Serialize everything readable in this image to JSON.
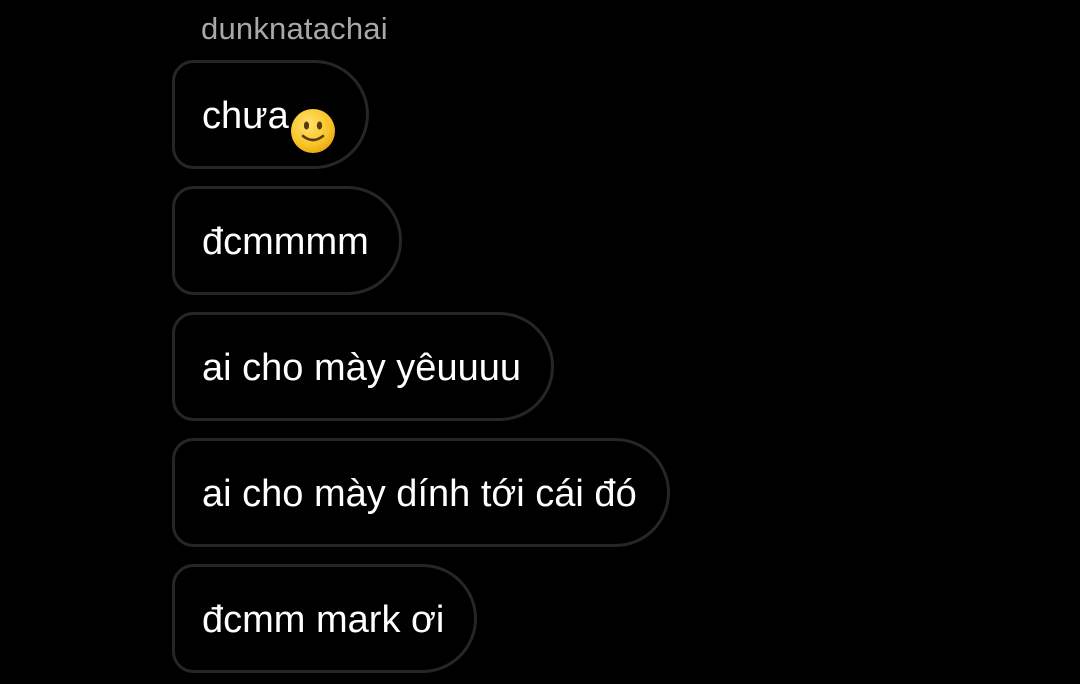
{
  "thread": {
    "sender_name": "dunknatachai",
    "messages": [
      {
        "text": "chưa",
        "emoji": "slightly-smiling-face-icon"
      },
      {
        "text": "đcmmmm"
      },
      {
        "text": "ai cho mày yêuuuu"
      },
      {
        "text": "ai cho mày dính tới cái đó"
      },
      {
        "text": "đcmm mark ơi"
      }
    ]
  },
  "colors": {
    "background": "#000000",
    "bubble_border": "#262626",
    "message_text": "#ffffff",
    "sender_text": "#a8a8a8",
    "emoji_face": "#f7c325"
  }
}
